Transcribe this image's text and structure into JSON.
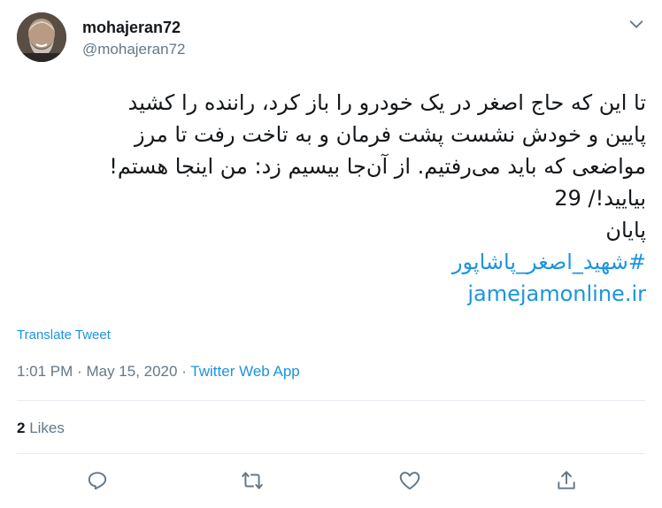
{
  "author": {
    "display_name": "mohajeran72",
    "handle": "@mohajeran72",
    "avatar_icon": "profile-photo",
    "menu_icon": "chevron-down-icon"
  },
  "tweet": {
    "lines": [
      "تا این که حاج اصغر در یک خودرو را باز کرد، راننده را کشید",
      "پایین و خودش نشست پشت فرمان و به تاخت رفت تا مرز",
      "مواضعی که باید می‌رفتیم. از آن‌جا بیسیم زد: من اینجا هستم!",
      "بیایید!/ 29",
      "پایان"
    ],
    "hashtag": "#شهید_اصغر_پاشاپور",
    "link": "jamejamonline.ir",
    "translate_label": "Translate Tweet"
  },
  "meta": {
    "time": "1:01 PM",
    "separator": "·",
    "date": "May 15, 2020",
    "source": "Twitter Web App"
  },
  "stats": {
    "likes_count": "2",
    "likes_label": "Likes"
  },
  "actions": {
    "reply_icon": "reply-icon",
    "retweet_icon": "retweet-icon",
    "like_icon": "heart-icon",
    "share_icon": "share-icon"
  },
  "colors": {
    "link": "#1b95e0",
    "secondary_text": "#657786",
    "primary_text": "#14171a",
    "divider": "#e6ecf0"
  }
}
